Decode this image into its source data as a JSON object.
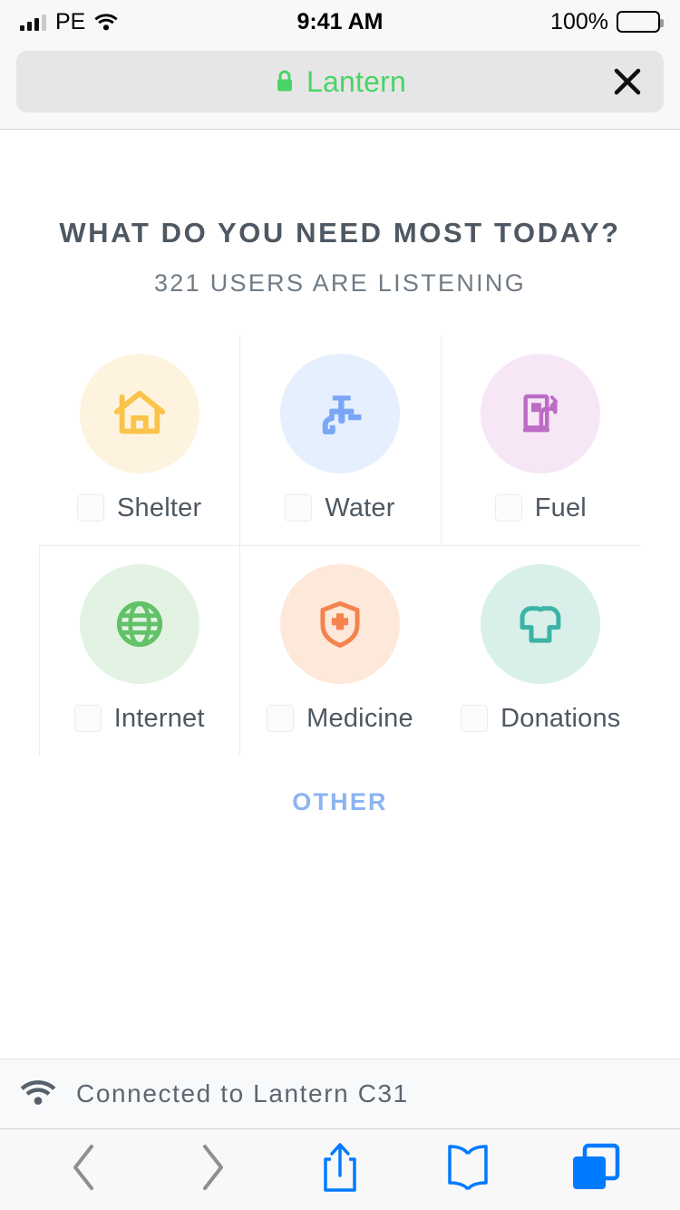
{
  "status_bar": {
    "carrier": "PE",
    "time": "9:41 AM",
    "battery_percent": "100%",
    "signal_icon": "signal-bars-icon",
    "wifi_icon": "wifi-icon",
    "battery_icon": "battery-full-icon"
  },
  "browser": {
    "url_text": "Lantern",
    "lock_icon": "lock-icon",
    "close_icon": "close-icon",
    "secure_color": "#4ad366"
  },
  "page": {
    "title": "WHAT DO YOU NEED MOST TODAY?",
    "subtitle": "321 USERS ARE LISTENING",
    "other_label": "OTHER",
    "other_color": "#8cb4f0",
    "title_color": "#4e5862"
  },
  "needs": [
    {
      "label": "Shelter",
      "icon": "house-icon",
      "bubble_color": "#fdf3de",
      "icon_color": "#fbc34a",
      "checked": false
    },
    {
      "label": "Water",
      "icon": "faucet-icon",
      "bubble_color": "#e6effd",
      "icon_color": "#7aa7f5",
      "checked": false
    },
    {
      "label": "Fuel",
      "icon": "fuel-pump-icon",
      "bubble_color": "#f6e6f6",
      "icon_color": "#bd6cc6",
      "checked": false
    },
    {
      "label": "Internet",
      "icon": "globe-icon",
      "bubble_color": "#e3f3e3",
      "icon_color": "#63c167",
      "checked": false
    },
    {
      "label": "Medicine",
      "icon": "shield-cross-icon",
      "bubble_color": "#fde8da",
      "icon_color": "#f4834d",
      "checked": false
    },
    {
      "label": "Donations",
      "icon": "tshirt-icon",
      "bubble_color": "#d9f0ea",
      "icon_color": "#3bb3a5",
      "checked": false
    }
  ],
  "connection": {
    "text": "Connected to Lantern C31",
    "icon": "wifi-icon"
  },
  "toolbar": {
    "back_icon": "chevron-left-icon",
    "forward_icon": "chevron-right-icon",
    "share_icon": "share-icon",
    "bookmarks_icon": "book-icon",
    "tabs_icon": "tabs-icon",
    "inactive_color": "#8e8e93",
    "active_color": "#007aff"
  }
}
